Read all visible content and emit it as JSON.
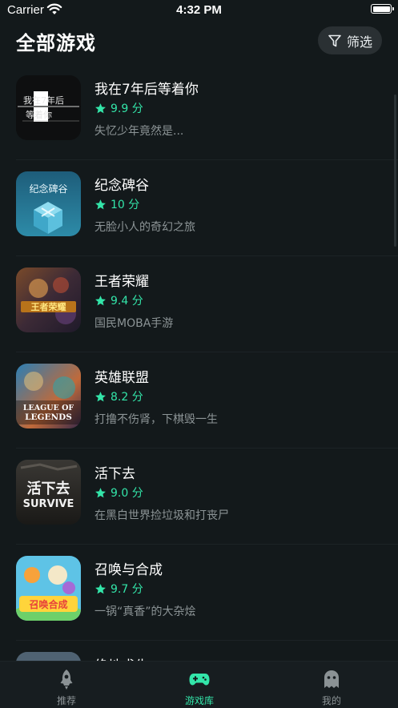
{
  "status_bar": {
    "carrier": "Carrier",
    "time": "4:32 PM"
  },
  "header": {
    "title": "全部游戏",
    "filter_label": "筛选"
  },
  "games": [
    {
      "name": "我在7年后等着你",
      "rating": "9.9 分",
      "desc": "失忆少年竟然是...",
      "thumb_lines": [
        "我在7年后",
        "等着你"
      ]
    },
    {
      "name": "纪念碑谷",
      "rating": "10 分",
      "desc": "无脸小人的奇幻之旅",
      "thumb_lines": [
        "纪念碑谷"
      ]
    },
    {
      "name": "王者荣耀",
      "rating": "9.4 分",
      "desc": "国民MOBA手游",
      "thumb_lines": [
        "王者荣耀"
      ]
    },
    {
      "name": "英雄联盟",
      "rating": "8.2 分",
      "desc": "打撸不伤肾，下棋毁一生",
      "thumb_lines": [
        "LEAGUE OF",
        "LEGENDS"
      ]
    },
    {
      "name": "活下去",
      "rating": "9.0 分",
      "desc": "在黑白世界捡垃圾和打丧尸",
      "thumb_lines": [
        "活下去",
        "SURVIVE"
      ]
    },
    {
      "name": "召唤与合成",
      "rating": "9.7 分",
      "desc": "一锅“真香”的大杂烩",
      "thumb_lines": [
        "召唤合成"
      ]
    },
    {
      "name": "绝地求生",
      "rating": "",
      "desc": "",
      "thumb_lines": []
    }
  ],
  "tabs": [
    {
      "label": "推荐",
      "icon": "rocket-icon"
    },
    {
      "label": "游戏库",
      "icon": "gamepad-icon",
      "active": true
    },
    {
      "label": "我的",
      "icon": "ghost-icon"
    }
  ],
  "colors": {
    "background": "#13191b",
    "accent": "#33e5a9",
    "muted_text": "#8c9496"
  }
}
